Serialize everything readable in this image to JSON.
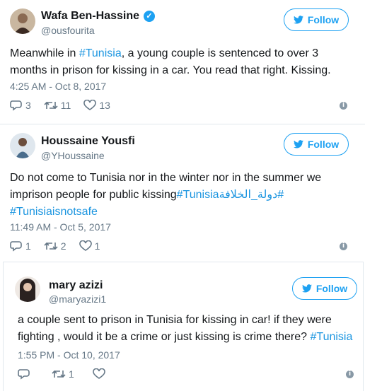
{
  "tweets": [
    {
      "name": "Wafa Ben-Hassine",
      "handle": "@ousfourita",
      "verified": true,
      "follow_label": "Follow",
      "text_parts": [
        "Meanwhile in ",
        "#Tunisia",
        ", a young couple is sentenced to over 3 months in prison for kissing in a car. You read that right. Kissing."
      ],
      "time": "4:25 AM - Oct 8, 2017",
      "replies": "3",
      "retweets": "11",
      "likes": "13"
    },
    {
      "name": "Houssaine Yousfi",
      "handle": "@YHoussaine",
      "follow_label": "Follow",
      "text_plain": "Do not come to Tunisia nor in the winter nor in the summer we imprison people for public kissing",
      "tag1": "#Tunisia",
      "tag2": "#دولة_الخلافة",
      "tag3": "#Tunisiaisnotsafe",
      "time": "11:49 AM - Oct 5, 2017",
      "replies": "1",
      "retweets": "2",
      "likes": "1"
    },
    {
      "name": "mary azizi",
      "handle": "@maryazizi1",
      "follow_label": "Follow",
      "text_plain": "a couple sent to prison in Tunisia for kissing in car! if they were fighting , would it be a crime or just kissing is crime there? ",
      "tag": "#Tunisia",
      "time": "1:55 PM - Oct 10, 2017",
      "retweets": "1"
    }
  ],
  "colors": {
    "accent": "#1da1f2",
    "link": "#1b95e0",
    "muted": "#657786"
  },
  "icons": [
    "reply-icon",
    "retweet-icon",
    "like-icon",
    "info-icon",
    "twitter-bird-icon",
    "verified-badge-icon"
  ]
}
